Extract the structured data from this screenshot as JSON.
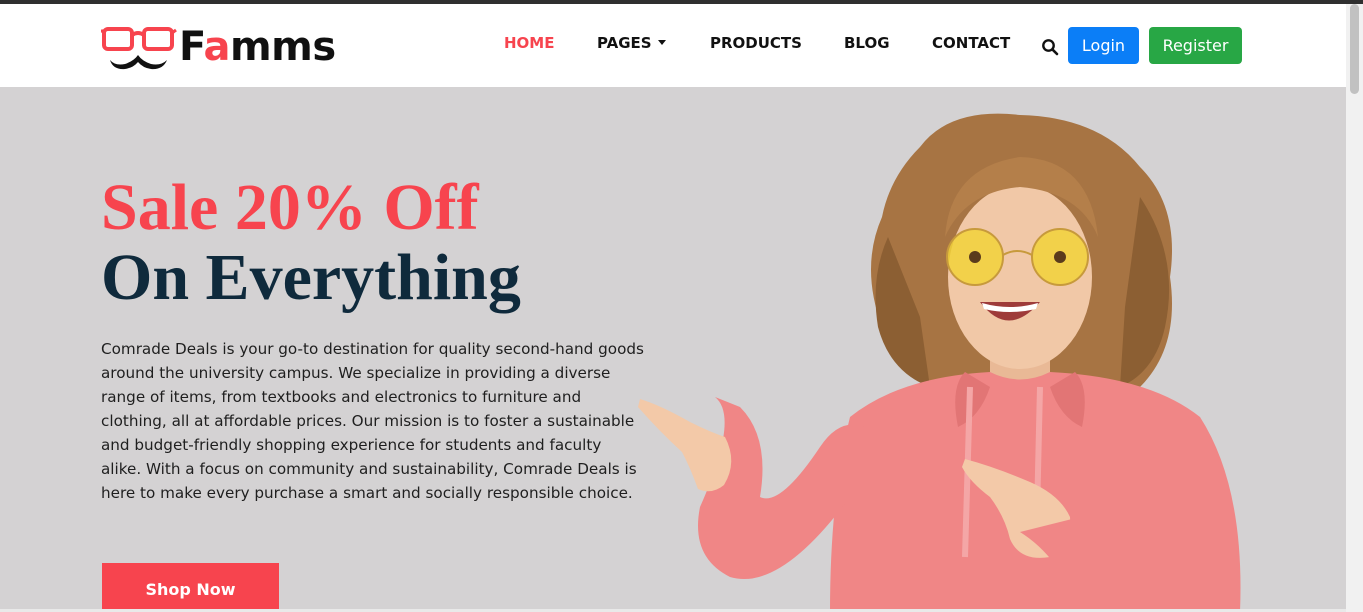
{
  "brand": {
    "name_prefix": "F",
    "name_accent": "a",
    "name_suffix": "mms",
    "accent_color": "#f7444e"
  },
  "nav": {
    "items": [
      {
        "label": "HOME",
        "active": true
      },
      {
        "label": "PAGES",
        "has_dropdown": true
      },
      {
        "label": "PRODUCTS"
      },
      {
        "label": "BLOG"
      },
      {
        "label": "CONTACT"
      }
    ],
    "search_icon": "search-icon",
    "login_label": "Login",
    "register_label": "Register"
  },
  "hero": {
    "title_line1": "Sale 20% Off",
    "title_line2": "On Everything",
    "description": "Comrade Deals is your go-to destination for quality second-hand goods around the university campus. We specialize in providing a diverse range of items, from textbooks and electronics to furniture and clothing, all at affordable prices. Our mission is to foster a sustainable and budget-friendly shopping experience for students and faculty alike. With a focus on community and sustainability, Comrade Deals is here to make every purchase a smart and socially responsible choice.",
    "cta_label": "Shop Now"
  },
  "colors": {
    "primary_red": "#f7444e",
    "dark_navy": "#0f2a3c",
    "login_blue": "#0b7ef7",
    "register_green": "#28a745",
    "hero_bg": "#d4d2d3"
  }
}
